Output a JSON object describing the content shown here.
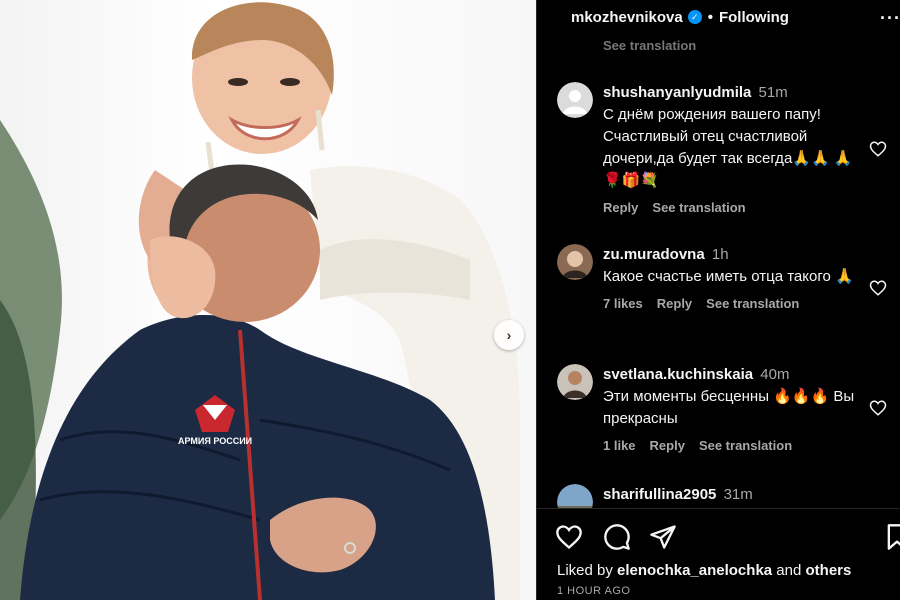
{
  "post": {
    "username": "mkozhevnikova",
    "follow_state": "Following",
    "more_label": "···"
  },
  "comments_top_partial": "See translation",
  "comments": [
    {
      "user": "shushanyanlyudmila",
      "time": "51m",
      "text": "С днём рождения вашего папу! Счастливый отец счастливой дочери,да будет так всегда🙏🙏 🙏🌹🎁💐",
      "likes": "",
      "reply": "Reply",
      "translate": "See translation"
    },
    {
      "user": "zu.muradovna",
      "time": "1h",
      "text": "Какое счастье иметь отца такого 🙏",
      "likes": "7 likes",
      "reply": "Reply",
      "translate": "See translation"
    },
    {
      "user": "svetlana.kuchinskaia",
      "time": "40m",
      "text": "Эти моменты бесценны 🔥🔥🔥 Вы прекрасны",
      "likes": "1 like",
      "reply": "Reply",
      "translate": "See translation"
    },
    {
      "user": "sharifullina2905",
      "time": "31m",
      "text": "",
      "likes": "",
      "reply": "",
      "translate": ""
    }
  ],
  "footer": {
    "liked_prefix": "Liked by",
    "liked_user": "elenochka_anelochka",
    "liked_and": "and",
    "liked_others": "others",
    "time_ago": "1 HOUR AGO"
  },
  "photo": {
    "patch_text": "АРМИЯ РОССИИ"
  },
  "colors": {
    "background": "#000000",
    "text": "#f5f5f5",
    "secondary": "#a8a8a8",
    "verified": "#0095f6",
    "jacket": "#1c2a44"
  }
}
